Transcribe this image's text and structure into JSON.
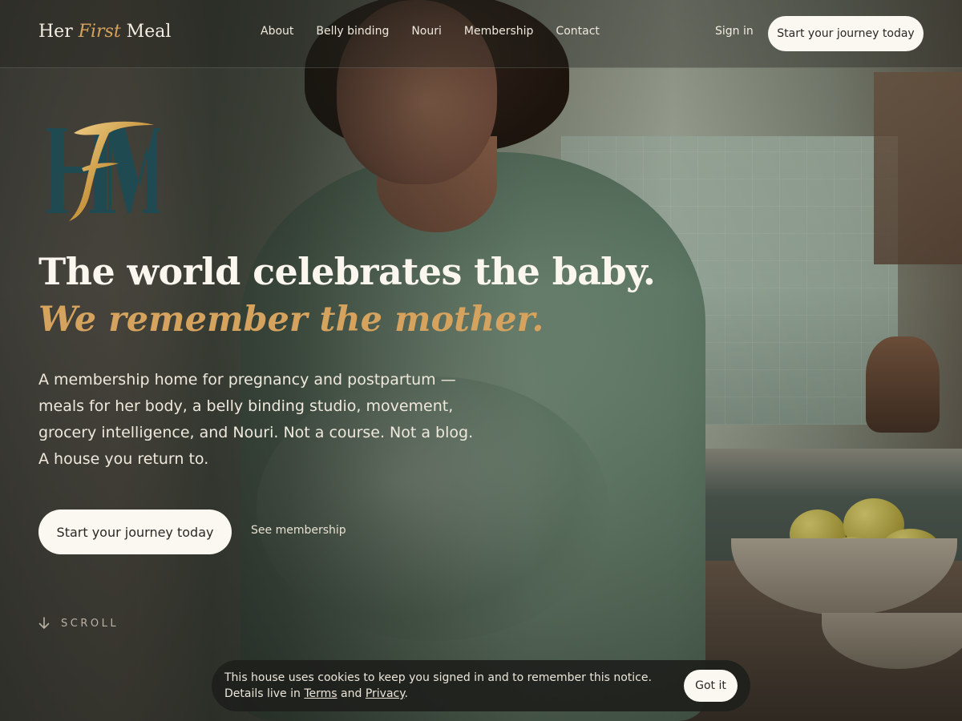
{
  "brand": {
    "part1": "Her ",
    "accent": "First",
    "part2": " Meal"
  },
  "nav": {
    "links": [
      "About",
      "Belly binding",
      "Nouri",
      "Membership",
      "Contact"
    ],
    "sign_in": "Sign in",
    "cta": "Start your journey today"
  },
  "logo": {
    "letters": "HFM"
  },
  "hero": {
    "title": "The world celebrates the baby.",
    "subtitle": "We remember the mother.",
    "lead_lines": [
      "A membership home for pregnancy and postpartum —",
      "meals for her body, a belly binding studio, movement,",
      "grocery intelligence, and Nouri. Not a course. Not a blog.",
      "A house you return to."
    ],
    "primary_cta": "Start your journey today",
    "secondary_cta": "See membership",
    "scroll_label": "SCROLL"
  },
  "cookie": {
    "text": "This house uses cookies to keep you signed in and to remember this notice. Details live in ",
    "terms": "Terms",
    "and": " and ",
    "privacy": "Privacy",
    "end": ".",
    "button": "Got it"
  },
  "colors": {
    "accent_gold": "#d6a35e",
    "cream": "#fbf7f1",
    "logo_teal": "#1f4a52"
  },
  "icons": {
    "scroll": "arrow-down-icon"
  }
}
